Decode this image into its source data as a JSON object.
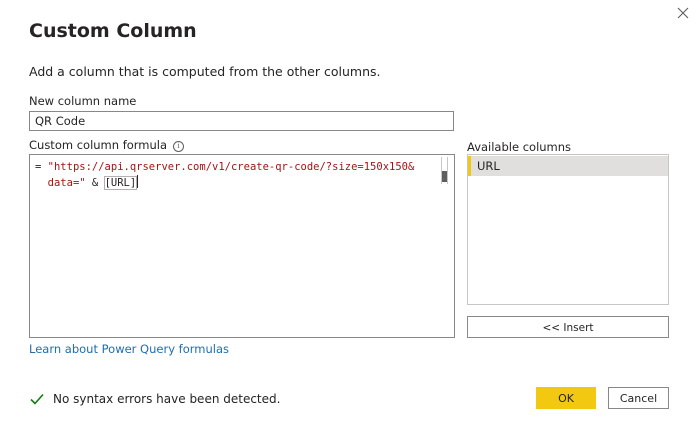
{
  "dialog": {
    "title": "Custom Column",
    "description": "Add a column that is computed from the other columns."
  },
  "new_column": {
    "label": "New column name",
    "value": "QR Code"
  },
  "formula": {
    "label": "Custom column formula",
    "info_icon": "i",
    "line1_op": "= ",
    "line1_str": "\"https://api.qrserver.com/v1/create-qr-code/?size=150x150&",
    "line2_str": "data=\"",
    "line2_op": " & ",
    "line2_ref": "[URL]"
  },
  "available_columns": {
    "label": "Available columns",
    "items": [
      "URL"
    ],
    "selected": "URL",
    "insert_label": "<< Insert"
  },
  "learn_link": "Learn about Power Query formulas",
  "status": {
    "text": "No syntax errors have been detected.",
    "icon": "check-icon",
    "color": "#107c10"
  },
  "buttons": {
    "ok": "OK",
    "cancel": "Cancel"
  },
  "colors": {
    "accent": "#f2c811",
    "link": "#1f6db0",
    "string": "#a31515"
  }
}
